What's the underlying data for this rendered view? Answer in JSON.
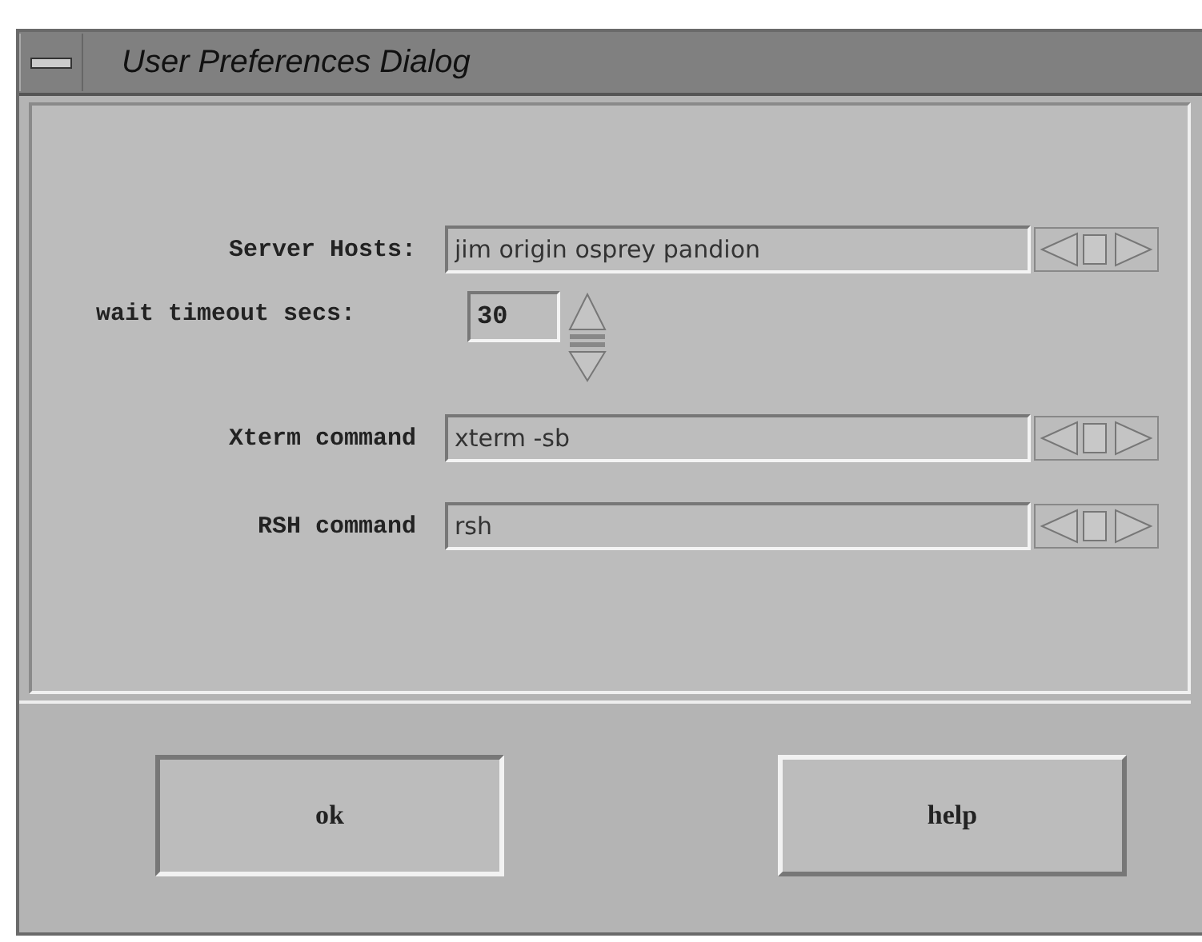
{
  "window": {
    "title": "User Preferences Dialog"
  },
  "fields": [
    {
      "kind": "text",
      "label": "Server Hosts:",
      "value": "jim origin osprey pandion"
    },
    {
      "kind": "spinner",
      "label": "wait timeout secs:",
      "value": "30"
    },
    {
      "kind": "text",
      "label": "Xterm command",
      "value": "xterm -sb"
    },
    {
      "kind": "text",
      "label": "RSH command",
      "value": "rsh"
    }
  ],
  "buttons": [
    {
      "label": "ok",
      "pressed": true
    },
    {
      "label": "help",
      "pressed": false
    }
  ]
}
